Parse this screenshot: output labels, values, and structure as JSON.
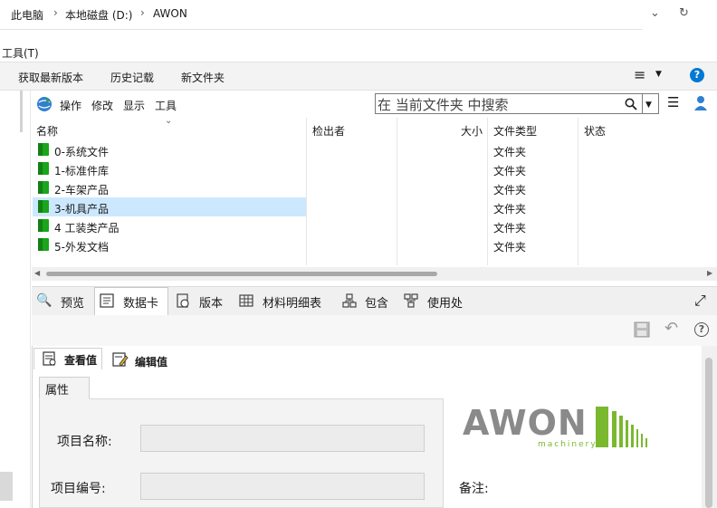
{
  "breadcrumb": [
    "此电脑",
    "本地磁盘 (D:)",
    "AWON"
  ],
  "menu": {
    "tools": "工具(T)"
  },
  "commands": [
    "获取最新版本",
    "历史记载",
    "新文件夹"
  ],
  "pdm_menu": [
    "操作",
    "修改",
    "显示",
    "工具"
  ],
  "search": {
    "placeholder": "在 当前文件夹 中搜索"
  },
  "columns": {
    "name": "名称",
    "checked_out_by": "检出者",
    "size": "大小",
    "file_type": "文件类型",
    "status": "状态"
  },
  "files": [
    {
      "name": "0-系统文件",
      "type": "文件夹",
      "selected": false
    },
    {
      "name": "1-标准件库",
      "type": "文件夹",
      "selected": false
    },
    {
      "name": "2-车架产品",
      "type": "文件夹",
      "selected": false
    },
    {
      "name": "3-机具产品",
      "type": "文件夹",
      "selected": true
    },
    {
      "name": "4 工装类产品",
      "type": "文件夹",
      "selected": false
    },
    {
      "name": "5-外发文档",
      "type": "文件夹",
      "selected": false
    }
  ],
  "tabs": [
    "预览",
    "数据卡",
    "版本",
    "材料明细表",
    "包含",
    "使用处"
  ],
  "active_tab": "数据卡",
  "datacard": {
    "view_tabs": [
      "查看值",
      "编辑值"
    ],
    "group_tab": "属性",
    "fields": [
      {
        "label": "项目名称:",
        "value": ""
      },
      {
        "label": "项目编号:",
        "value": ""
      }
    ],
    "note_label": "备注:",
    "logo": {
      "main": "AWON",
      "sub": "machinery"
    }
  },
  "colors": {
    "accent": "#0078d4",
    "selection": "#cce8ff",
    "folder": "#1aa51a",
    "logo_gray": "#8a8a8a",
    "logo_green": "#7ab82f"
  }
}
